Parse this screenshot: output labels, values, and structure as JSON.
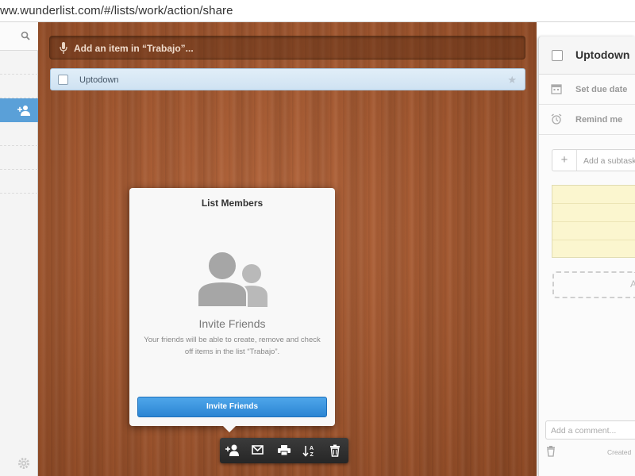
{
  "browser": {
    "url": "ww.wunderlist.com/#/lists/work/action/share"
  },
  "sidebar": {
    "search_icon": "search-icon",
    "active_item_icon": "add-user-icon",
    "settings_icon": "gear-icon"
  },
  "main": {
    "add_item_placeholder": "Add an item in “Trabajo”...",
    "tasks": [
      {
        "title": "Uptodown",
        "starred": false
      }
    ]
  },
  "share_popup": {
    "title": "List Members",
    "heading": "Invite Friends",
    "description": "Your friends will be able to create, remove and check off items in the list “Trabajo”.",
    "button_label": "Invite Friends"
  },
  "toolbar": {
    "buttons": [
      "add-member-icon",
      "email-icon",
      "print-icon",
      "sort-icon",
      "trash-icon"
    ]
  },
  "detail": {
    "task_title": "Uptodown",
    "due_date_label": "Set due date",
    "reminder_label": "Remind me",
    "subtask_placeholder": "Add a subtask",
    "upload_char": "A",
    "comment_placeholder": "Add a comment...",
    "created_label": "Created"
  },
  "colors": {
    "accent": "#2b85d3",
    "sidebar_active": "#5aa0d8",
    "wood": "#a55a32",
    "note": "#fbf6cf"
  }
}
